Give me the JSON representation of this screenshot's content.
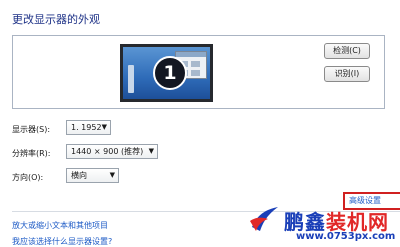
{
  "header": {
    "title": "更改显示器的外观"
  },
  "preview": {
    "monitor_number": "1",
    "detect_label": "检测(C)",
    "identify_label": "识别(I)"
  },
  "settings": {
    "display": {
      "label": "显示器(S):",
      "value": "1. 1952"
    },
    "resolution": {
      "label": "分辨率(R):",
      "value": "1440 × 900 (推荐)"
    },
    "orientation": {
      "label": "方向(O):",
      "value": "横向"
    }
  },
  "advanced_link": "高级设置",
  "links": [
    {
      "label": "放大或缩小文本和其他项目"
    },
    {
      "label": "我应该选择什么显示器设置?"
    }
  ],
  "watermark": {
    "brand_part1": "鹏鑫",
    "brand_part2": "装机网",
    "url": "www.0753px.com"
  },
  "colors": {
    "title": "#1e3287",
    "link": "#1e5bc6",
    "highlight_border": "#d02020",
    "brand_blue": "#1a3fb8",
    "brand_red": "#e12828"
  }
}
